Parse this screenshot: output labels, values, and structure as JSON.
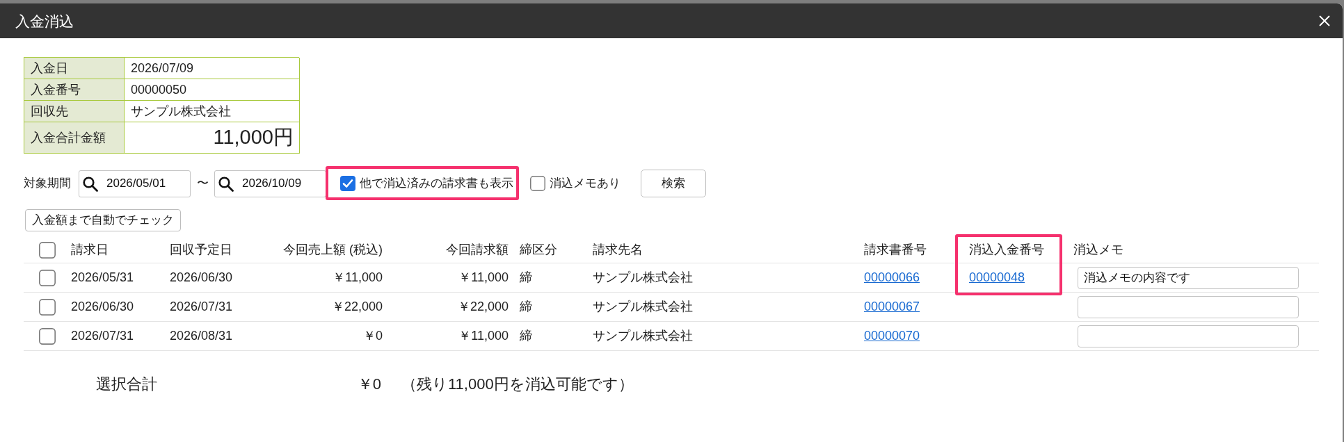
{
  "dialog": {
    "title": "入金消込"
  },
  "payment_info": [
    {
      "kind": "field",
      "label": "入金日",
      "value": "2026/07/09"
    },
    {
      "kind": "field",
      "label": "入金番号",
      "value": "00000050"
    },
    {
      "kind": "field",
      "label": "回収先",
      "value": "サンプル株式会社"
    },
    {
      "kind": "total",
      "label": "入金合計金額",
      "value": "11,000円"
    }
  ],
  "filter": {
    "period_label": "対象期間",
    "date_from": "2026/05/01",
    "separator": "〜",
    "date_to": "2026/10/09",
    "options": [
      {
        "label": "他で消込済みの請求書も表示",
        "checked": true,
        "highlighted": true
      },
      {
        "label": "消込メモあり",
        "checked": false,
        "highlighted": false
      }
    ],
    "search_button": "検索"
  },
  "auto_check_button": "入金額まで自動でチェック",
  "table": {
    "select_all": {
      "checked": false
    },
    "columns": [
      {
        "label": "請求日",
        "kind": "text",
        "highlighted": false
      },
      {
        "label": "回収予定日",
        "kind": "text",
        "highlighted": false
      },
      {
        "label": "今回売上額 (税込)",
        "kind": "amount",
        "highlighted": false
      },
      {
        "label": "今回請求額",
        "kind": "amount",
        "highlighted": false
      },
      {
        "label": "締区分",
        "kind": "text",
        "highlighted": false
      },
      {
        "label": "請求先名",
        "kind": "text",
        "highlighted": false
      },
      {
        "label": "請求書番号",
        "kind": "link",
        "highlighted": false
      },
      {
        "label": "消込入金番号",
        "kind": "link",
        "highlighted": true
      },
      {
        "label": "消込メモ",
        "kind": "memo",
        "highlighted": false
      }
    ],
    "rows": [
      {
        "checked": false,
        "invoice_date": "2026/05/31",
        "due_date": "2026/06/30",
        "sales_amount": "￥11,000",
        "billed_amount": "￥11,000",
        "closing_type": "締",
        "customer": "サンプル株式会社",
        "invoice_no": "00000066",
        "payment_no": "00000048",
        "memo": "消込メモの内容です"
      },
      {
        "checked": false,
        "invoice_date": "2026/06/30",
        "due_date": "2026/07/31",
        "sales_amount": "￥22,000",
        "billed_amount": "￥22,000",
        "closing_type": "締",
        "customer": "サンプル株式会社",
        "invoice_no": "00000067"
      },
      {
        "checked": false,
        "invoice_date": "2026/07/31",
        "due_date": "2026/08/31",
        "sales_amount": "￥0",
        "billed_amount": "￥11,000",
        "closing_type": "締",
        "customer": "サンプル株式会社",
        "invoice_no": "00000070"
      }
    ]
  },
  "summary": {
    "label": "選択合計",
    "amount": "￥0",
    "note": "（残り11,000円を消込可能です）"
  }
}
